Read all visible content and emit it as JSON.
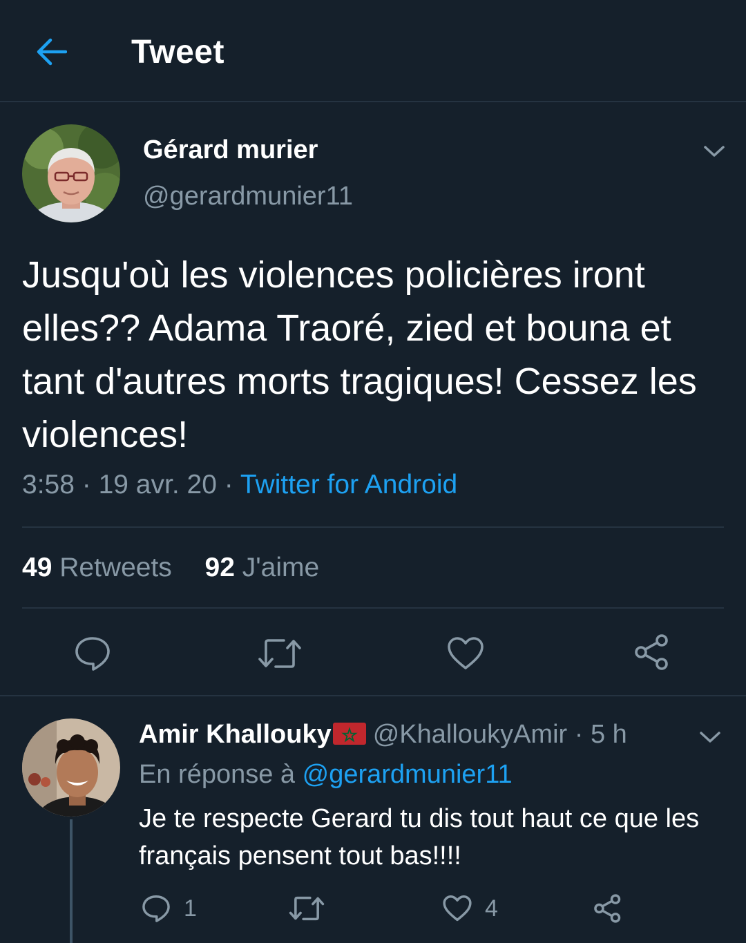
{
  "header": {
    "title": "Tweet",
    "icon": "back-arrow-icon",
    "accent": "#1da1f2"
  },
  "tweet": {
    "author_name": "Gérard murier",
    "author_handle": "@gerardmunier11",
    "text": "Jusqu'où les violences policières iront elles?? Adama Traoré, zied et bouna et tant d'autres morts tragiques! Cessez les violences!",
    "time": "3:58",
    "separator": "·",
    "date": "19 avr. 20",
    "source": "Twitter for Android",
    "retweets_count": "49",
    "retweets_label": "Retweets",
    "likes_count": "92",
    "likes_label": "J'aime",
    "actions": [
      "reply-icon",
      "retweet-icon",
      "like-icon",
      "share-icon"
    ]
  },
  "reply": {
    "author_name": "Amir Khallouky",
    "flag": "morocco-flag-icon",
    "handle": "@KhalloukyAmir",
    "separator": "·",
    "time": "5 h",
    "reply_prefix": "En réponse à",
    "reply_mention": "@gerardmunier11",
    "text": "Je te respecte Gerard tu dis tout haut ce que les français pensent tout bas!!!!",
    "reply_count": "1",
    "like_count": "4"
  },
  "colors": {
    "background": "#15202b",
    "divider": "#253341",
    "secondary_text": "#8899a6",
    "link": "#1da1f2"
  }
}
